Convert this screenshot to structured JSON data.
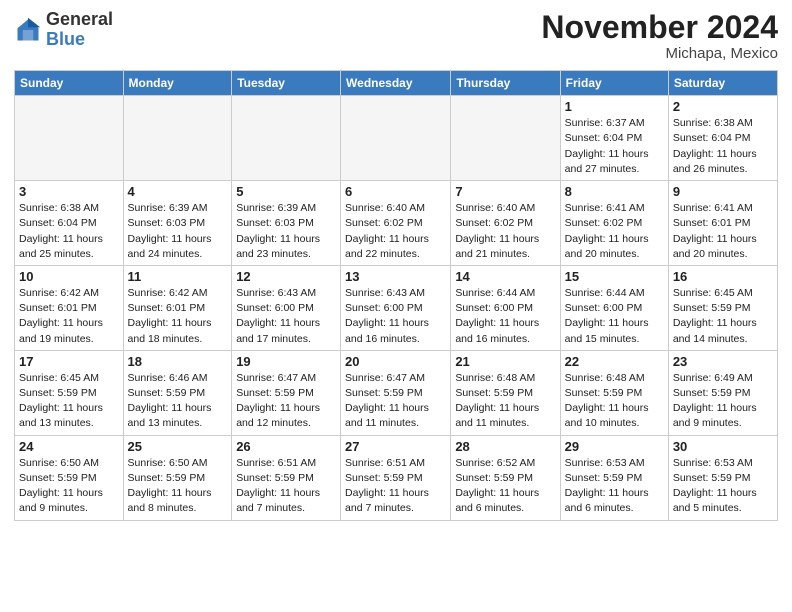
{
  "header": {
    "logo_general": "General",
    "logo_blue": "Blue",
    "month_title": "November 2024",
    "location": "Michapa, Mexico"
  },
  "days_of_week": [
    "Sunday",
    "Monday",
    "Tuesday",
    "Wednesday",
    "Thursday",
    "Friday",
    "Saturday"
  ],
  "weeks": [
    [
      {
        "day": "",
        "info": ""
      },
      {
        "day": "",
        "info": ""
      },
      {
        "day": "",
        "info": ""
      },
      {
        "day": "",
        "info": ""
      },
      {
        "day": "",
        "info": ""
      },
      {
        "day": "1",
        "info": "Sunrise: 6:37 AM\nSunset: 6:04 PM\nDaylight: 11 hours and 27 minutes."
      },
      {
        "day": "2",
        "info": "Sunrise: 6:38 AM\nSunset: 6:04 PM\nDaylight: 11 hours and 26 minutes."
      }
    ],
    [
      {
        "day": "3",
        "info": "Sunrise: 6:38 AM\nSunset: 6:04 PM\nDaylight: 11 hours and 25 minutes."
      },
      {
        "day": "4",
        "info": "Sunrise: 6:39 AM\nSunset: 6:03 PM\nDaylight: 11 hours and 24 minutes."
      },
      {
        "day": "5",
        "info": "Sunrise: 6:39 AM\nSunset: 6:03 PM\nDaylight: 11 hours and 23 minutes."
      },
      {
        "day": "6",
        "info": "Sunrise: 6:40 AM\nSunset: 6:02 PM\nDaylight: 11 hours and 22 minutes."
      },
      {
        "day": "7",
        "info": "Sunrise: 6:40 AM\nSunset: 6:02 PM\nDaylight: 11 hours and 21 minutes."
      },
      {
        "day": "8",
        "info": "Sunrise: 6:41 AM\nSunset: 6:02 PM\nDaylight: 11 hours and 20 minutes."
      },
      {
        "day": "9",
        "info": "Sunrise: 6:41 AM\nSunset: 6:01 PM\nDaylight: 11 hours and 20 minutes."
      }
    ],
    [
      {
        "day": "10",
        "info": "Sunrise: 6:42 AM\nSunset: 6:01 PM\nDaylight: 11 hours and 19 minutes."
      },
      {
        "day": "11",
        "info": "Sunrise: 6:42 AM\nSunset: 6:01 PM\nDaylight: 11 hours and 18 minutes."
      },
      {
        "day": "12",
        "info": "Sunrise: 6:43 AM\nSunset: 6:00 PM\nDaylight: 11 hours and 17 minutes."
      },
      {
        "day": "13",
        "info": "Sunrise: 6:43 AM\nSunset: 6:00 PM\nDaylight: 11 hours and 16 minutes."
      },
      {
        "day": "14",
        "info": "Sunrise: 6:44 AM\nSunset: 6:00 PM\nDaylight: 11 hours and 16 minutes."
      },
      {
        "day": "15",
        "info": "Sunrise: 6:44 AM\nSunset: 6:00 PM\nDaylight: 11 hours and 15 minutes."
      },
      {
        "day": "16",
        "info": "Sunrise: 6:45 AM\nSunset: 5:59 PM\nDaylight: 11 hours and 14 minutes."
      }
    ],
    [
      {
        "day": "17",
        "info": "Sunrise: 6:45 AM\nSunset: 5:59 PM\nDaylight: 11 hours and 13 minutes."
      },
      {
        "day": "18",
        "info": "Sunrise: 6:46 AM\nSunset: 5:59 PM\nDaylight: 11 hours and 13 minutes."
      },
      {
        "day": "19",
        "info": "Sunrise: 6:47 AM\nSunset: 5:59 PM\nDaylight: 11 hours and 12 minutes."
      },
      {
        "day": "20",
        "info": "Sunrise: 6:47 AM\nSunset: 5:59 PM\nDaylight: 11 hours and 11 minutes."
      },
      {
        "day": "21",
        "info": "Sunrise: 6:48 AM\nSunset: 5:59 PM\nDaylight: 11 hours and 11 minutes."
      },
      {
        "day": "22",
        "info": "Sunrise: 6:48 AM\nSunset: 5:59 PM\nDaylight: 11 hours and 10 minutes."
      },
      {
        "day": "23",
        "info": "Sunrise: 6:49 AM\nSunset: 5:59 PM\nDaylight: 11 hours and 9 minutes."
      }
    ],
    [
      {
        "day": "24",
        "info": "Sunrise: 6:50 AM\nSunset: 5:59 PM\nDaylight: 11 hours and 9 minutes."
      },
      {
        "day": "25",
        "info": "Sunrise: 6:50 AM\nSunset: 5:59 PM\nDaylight: 11 hours and 8 minutes."
      },
      {
        "day": "26",
        "info": "Sunrise: 6:51 AM\nSunset: 5:59 PM\nDaylight: 11 hours and 7 minutes."
      },
      {
        "day": "27",
        "info": "Sunrise: 6:51 AM\nSunset: 5:59 PM\nDaylight: 11 hours and 7 minutes."
      },
      {
        "day": "28",
        "info": "Sunrise: 6:52 AM\nSunset: 5:59 PM\nDaylight: 11 hours and 6 minutes."
      },
      {
        "day": "29",
        "info": "Sunrise: 6:53 AM\nSunset: 5:59 PM\nDaylight: 11 hours and 6 minutes."
      },
      {
        "day": "30",
        "info": "Sunrise: 6:53 AM\nSunset: 5:59 PM\nDaylight: 11 hours and 5 minutes."
      }
    ]
  ]
}
